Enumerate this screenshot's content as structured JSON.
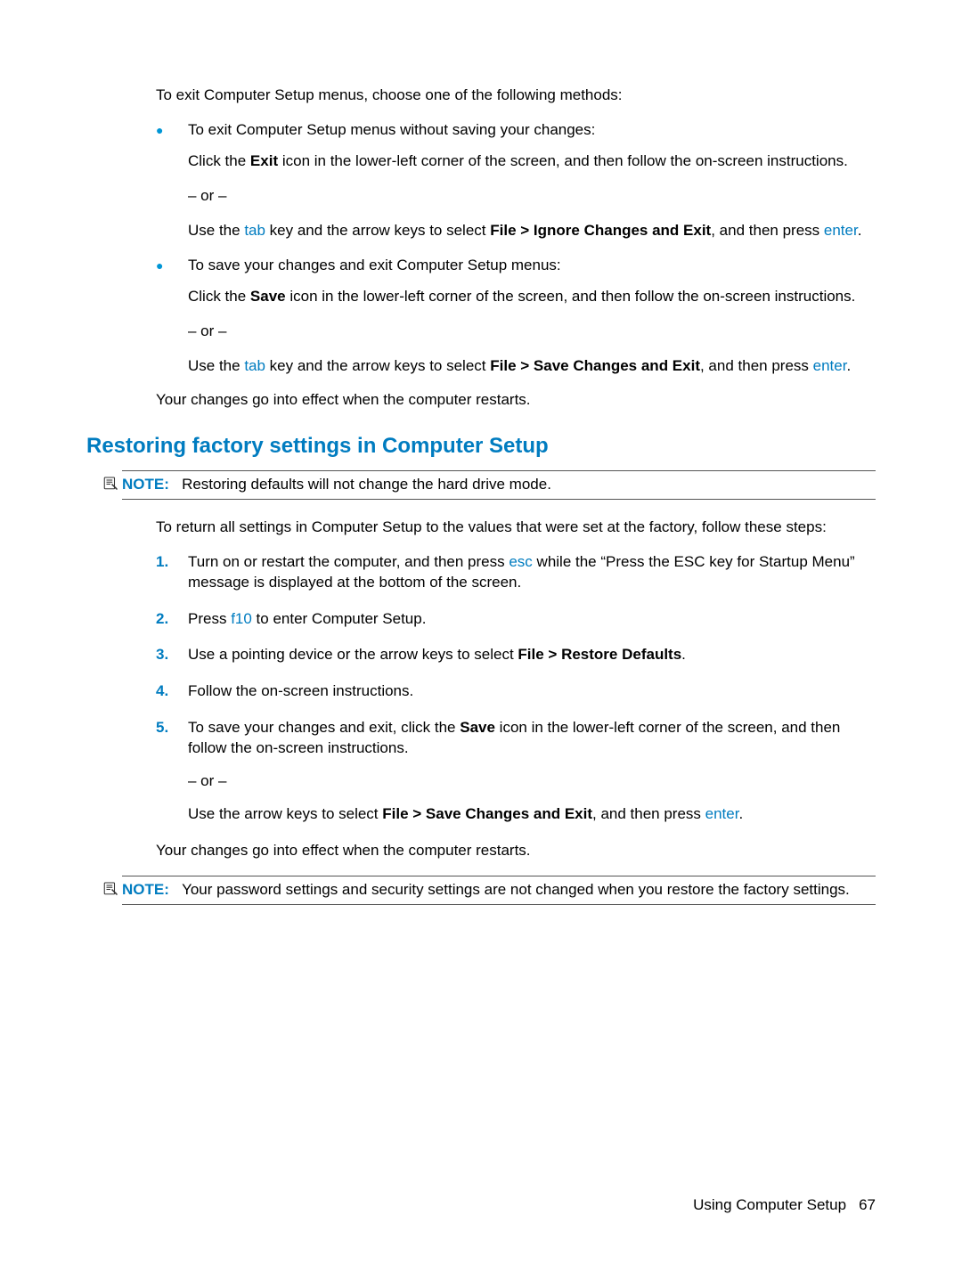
{
  "intro": "To exit Computer Setup menus, choose one of the following methods:",
  "bullet1": {
    "lead": "To exit Computer Setup menus without saving your changes:",
    "click_pre": "Click the ",
    "click_bold": "Exit",
    "click_post": " icon in the lower-left corner of the screen, and then follow the on-screen instructions.",
    "or": "– or –",
    "use_pre": "Use the ",
    "key_tab": "tab",
    "use_mid": " key and the arrow keys to select ",
    "menu_bold": "File > Ignore Changes and Exit",
    "use_post": ", and then press ",
    "key_enter": "enter",
    "period": "."
  },
  "bullet2": {
    "lead": "To save your changes and exit Computer Setup menus:",
    "click_pre": "Click the ",
    "click_bold": "Save",
    "click_post": " icon in the lower-left corner of the screen, and then follow the on-screen instructions.",
    "or": "– or –",
    "use_pre": "Use the ",
    "key_tab": "tab",
    "use_mid": " key and the arrow keys to select ",
    "menu_bold": "File > Save Changes and Exit",
    "use_post": ", and then press ",
    "key_enter": "enter",
    "period": "."
  },
  "after_bullets": "Your changes go into effect when the computer restarts.",
  "heading": "Restoring factory settings in Computer Setup",
  "note1": {
    "label": "NOTE:",
    "text": "Restoring defaults will not change the hard drive mode."
  },
  "return_intro": "To return all settings in Computer Setup to the values that were set at the factory, follow these steps:",
  "steps": {
    "s1_pre": "Turn on or restart the computer, and then press ",
    "s1_key": "esc",
    "s1_post": " while the “Press the ESC key for Startup Menu” message is displayed at the bottom of the screen.",
    "s2_pre": "Press ",
    "s2_key": "f10",
    "s2_post": " to enter Computer Setup.",
    "s3_pre": "Use a pointing device or the arrow keys to select ",
    "s3_bold": "File > Restore Defaults",
    "s3_post": ".",
    "s4": "Follow the on-screen instructions.",
    "s5_pre": "To save your changes and exit, click the ",
    "s5_bold": "Save",
    "s5_post": " icon in the lower-left corner of the screen, and then follow the on-screen instructions.",
    "s5_or": "– or –",
    "s5b_pre": "Use the arrow keys to select ",
    "s5b_bold": "File > Save Changes and Exit",
    "s5b_mid": ", and then press ",
    "s5b_key": "enter",
    "s5b_post": "."
  },
  "after_steps": "Your changes go into effect when the computer restarts.",
  "note2": {
    "label": "NOTE:",
    "text": "Your password settings and security settings are not changed when you restore the factory settings."
  },
  "footer": {
    "section": "Using Computer Setup",
    "page": "67"
  }
}
